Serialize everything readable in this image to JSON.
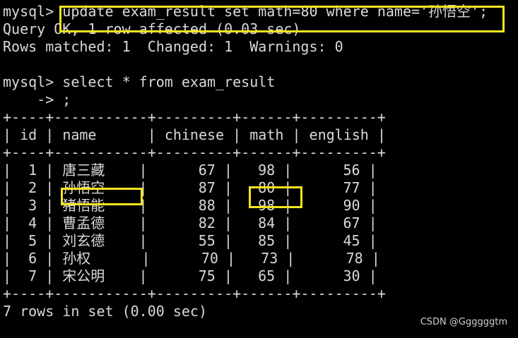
{
  "session": {
    "update_prompt": "mysql> ",
    "update_command": "update exam_result set math=80 where name='孙悟空';",
    "update_status": "Query OK, 1 row affected (0.03 sec)",
    "update_info": "Rows matched: 1  Changed: 1  Warnings: 0",
    "select_prompt": "mysql> ",
    "select_command": "select * from exam_result",
    "continuation": "    -> ;",
    "result_footer": "7 rows in set (0.00 sec)"
  },
  "table": {
    "border": "+----+-----------+---------+------+---------+",
    "columns": [
      "id",
      "name",
      "chinese",
      "math",
      "english"
    ],
    "rows": [
      {
        "id": "1",
        "name": "唐三藏",
        "chinese": "67",
        "math": "98",
        "english": "56"
      },
      {
        "id": "2",
        "name": "孙悟空",
        "chinese": "87",
        "math": "80",
        "english": "77"
      },
      {
        "id": "3",
        "name": "猪悟能",
        "chinese": "88",
        "math": "98",
        "english": "90"
      },
      {
        "id": "4",
        "name": "曹孟德",
        "chinese": "82",
        "math": "84",
        "english": "67"
      },
      {
        "id": "5",
        "name": "刘玄德",
        "chinese": "55",
        "math": "85",
        "english": "45"
      },
      {
        "id": "6",
        "name": "孙权",
        "chinese": "70",
        "math": "73",
        "english": "78"
      },
      {
        "id": "7",
        "name": "宋公明",
        "chinese": "75",
        "math": "65",
        "english": "30"
      }
    ]
  },
  "watermark": "CSDN @Ggggggtm",
  "colors": {
    "background": "#000000",
    "text": "#d9d9d9",
    "highlight": "#f5e51e"
  }
}
